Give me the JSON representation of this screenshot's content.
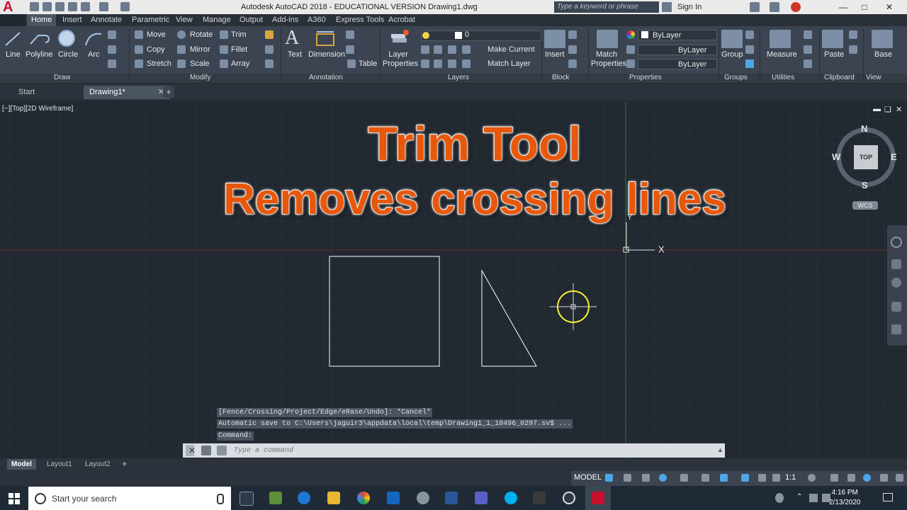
{
  "window": {
    "title": "Autodesk AutoCAD 2018 - EDUCATIONAL VERSION     Drawing1.dwg",
    "search_placeholder": "Type a keyword or phrase",
    "sign_in": "Sign In"
  },
  "ribbon_tabs": [
    "Home",
    "Insert",
    "Annotate",
    "Parametric",
    "View",
    "Manage",
    "Output",
    "Add-ins",
    "A360",
    "Express Tools",
    "Acrobat"
  ],
  "draw_panel": {
    "line": "Line",
    "polyline": "Polyline",
    "circle": "Circle",
    "arc": "Arc",
    "title": "Draw"
  },
  "modify_panel": {
    "move": "Move",
    "rotate": "Rotate",
    "trim": "Trim",
    "copy": "Copy",
    "mirror": "Mirror",
    "fillet": "Fillet",
    "stretch": "Stretch",
    "scale": "Scale",
    "array": "Array",
    "title": "Modify"
  },
  "annotation_panel": {
    "text": "Text",
    "dimension": "Dimension",
    "table": "Table",
    "title": "Annotation"
  },
  "layers_panel": {
    "layer_properties": "Layer Properties",
    "current_layer": "0",
    "make_current": "Make Current",
    "match_layer": "Match Layer",
    "title": "Layers"
  },
  "block_panel": {
    "insert": "Insert",
    "title": "Block"
  },
  "properties_panel": {
    "match_properties": "Match Properties",
    "color": "ByLayer",
    "linetype": "ByLayer",
    "lineweight": "ByLayer",
    "title": "Properties"
  },
  "groups_panel": {
    "group": "Group",
    "title": "Groups"
  },
  "utilities_panel": {
    "measure": "Measure",
    "title": "Utilities"
  },
  "clipboard_panel": {
    "paste": "Paste",
    "title": "Clipboard"
  },
  "view_panel": {
    "base": "Base",
    "title": "View"
  },
  "file_tabs": [
    "Start",
    "Drawing1*"
  ],
  "viewport": {
    "label": "[−][Top][2D Wireframe]"
  },
  "overlay": {
    "line1": "Trim Tool",
    "line2": "Removes crossing lines"
  },
  "viewcube": {
    "north": "N",
    "south": "S",
    "east": "E",
    "west": "W",
    "top": "TOP",
    "wcs": "WCS"
  },
  "ucs": {
    "y": "Y",
    "x": "X"
  },
  "command": {
    "history": [
      "[Fence/Crossing/Project/Edge/eRase/Undo]: *Cancel*",
      "Automatic save to C:\\Users\\jaguir3\\appdata\\local\\temp\\Drawing1_1_10496_0297.sv$ ...",
      "Command:"
    ],
    "placeholder": "Type a command"
  },
  "layout_tabs": [
    "Model",
    "Layout1",
    "Layout2"
  ],
  "status": {
    "model": "MODEL",
    "scale": "1:1"
  },
  "taskbar": {
    "search": "Start your search",
    "time": "4:16 PM",
    "date": "2/13/2020"
  }
}
